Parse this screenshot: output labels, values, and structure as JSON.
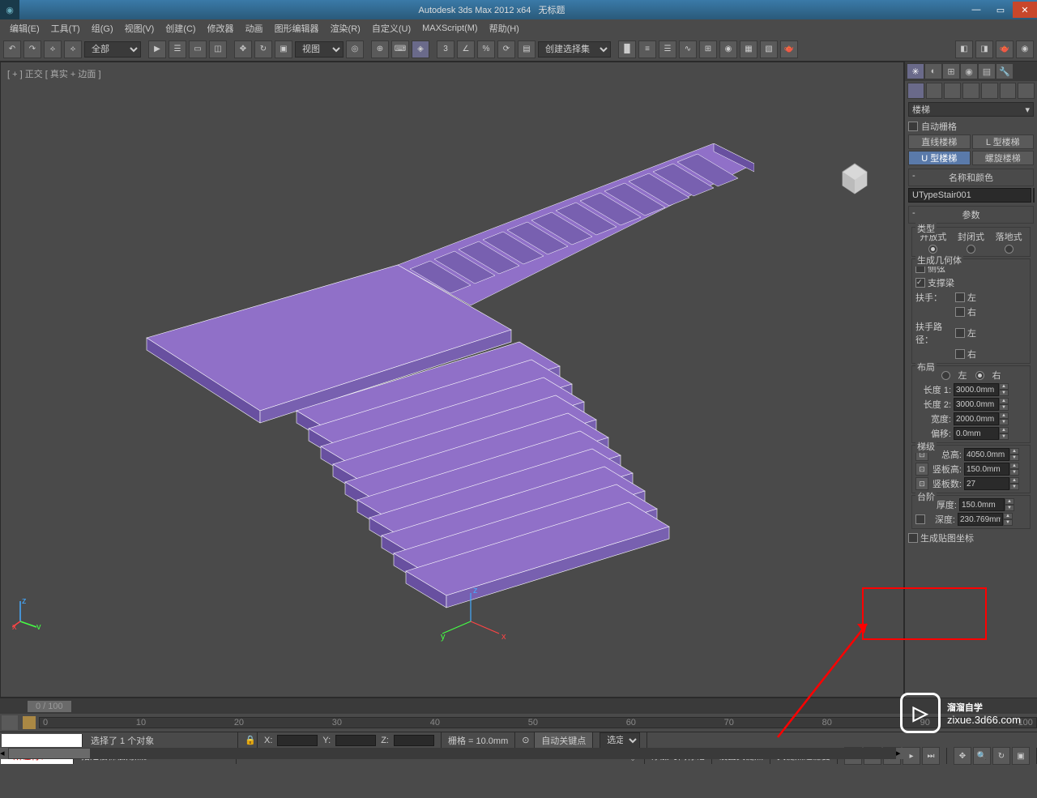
{
  "titlebar": {
    "app": "Autodesk 3ds Max 2012 x64",
    "doc": "无标题"
  },
  "menu": [
    "编辑(E)",
    "工具(T)",
    "组(G)",
    "视图(V)",
    "创建(C)",
    "修改器",
    "动画",
    "图形编辑器",
    "渲染(R)",
    "自定义(U)",
    "MAXScript(M)",
    "帮助(H)"
  ],
  "toolbar": {
    "filter": "全部",
    "view": "视图",
    "selset": "创建选择集"
  },
  "viewport": {
    "label": "[ + ] 正交 [ 真实 + 边面 ]"
  },
  "panel": {
    "dropdown": "楼梯",
    "autogrid": "自动栅格",
    "types": [
      "直线楼梯",
      "L 型楼梯",
      "U 型楼梯",
      "螺旋楼梯"
    ],
    "roll_name": "名称和颜色",
    "name": "UTypeStair001",
    "roll_params": "参数",
    "type_group": "类型",
    "type_opts": [
      "开放式",
      "封闭式",
      "落地式"
    ],
    "geom_group": "生成几何体",
    "geom": {
      "side": "侧弦",
      "support": "支撑梁",
      "handrail": "扶手：",
      "handpath": "扶手路径：",
      "left": "左",
      "right": "右"
    },
    "layout_group": "布局",
    "layout": {
      "left": "左",
      "right": "右",
      "len1": "长度 1:",
      "len2": "长度 2:",
      "width": "宽度:",
      "offset": "偏移:",
      "len1v": "3000.0mm",
      "len2v": "3000.0mm",
      "widthv": "2000.0mm",
      "offsetv": "0.0mm"
    },
    "flight_group": "梯级",
    "flight": {
      "height": "总高:",
      "riser": "竖板高:",
      "count": "竖板数:",
      "heightv": "4050.0mm",
      "riserv": "150.0mm",
      "countv": "27"
    },
    "step_group": "台阶",
    "step": {
      "thick": "厚度:",
      "depth": "深度:",
      "thickv": "150.0mm",
      "depthv": "230.769mm"
    },
    "genmap": "生成贴图坐标"
  },
  "timeline": {
    "frame": "0 / 100"
  },
  "status": {
    "sel": "选择了 1 个对象",
    "x": "X:",
    "y": "Y:",
    "z": "Z:",
    "grid": "栅格 = 10.0mm",
    "autokey": "自动关键点",
    "selfilter": "选定对",
    "prompt": "指定楼梯低角点。",
    "now": "所在行：",
    "addmarker": "添加时间标记",
    "setkey": "设置关键点",
    "keyfilter": "关键点过滤器"
  }
}
